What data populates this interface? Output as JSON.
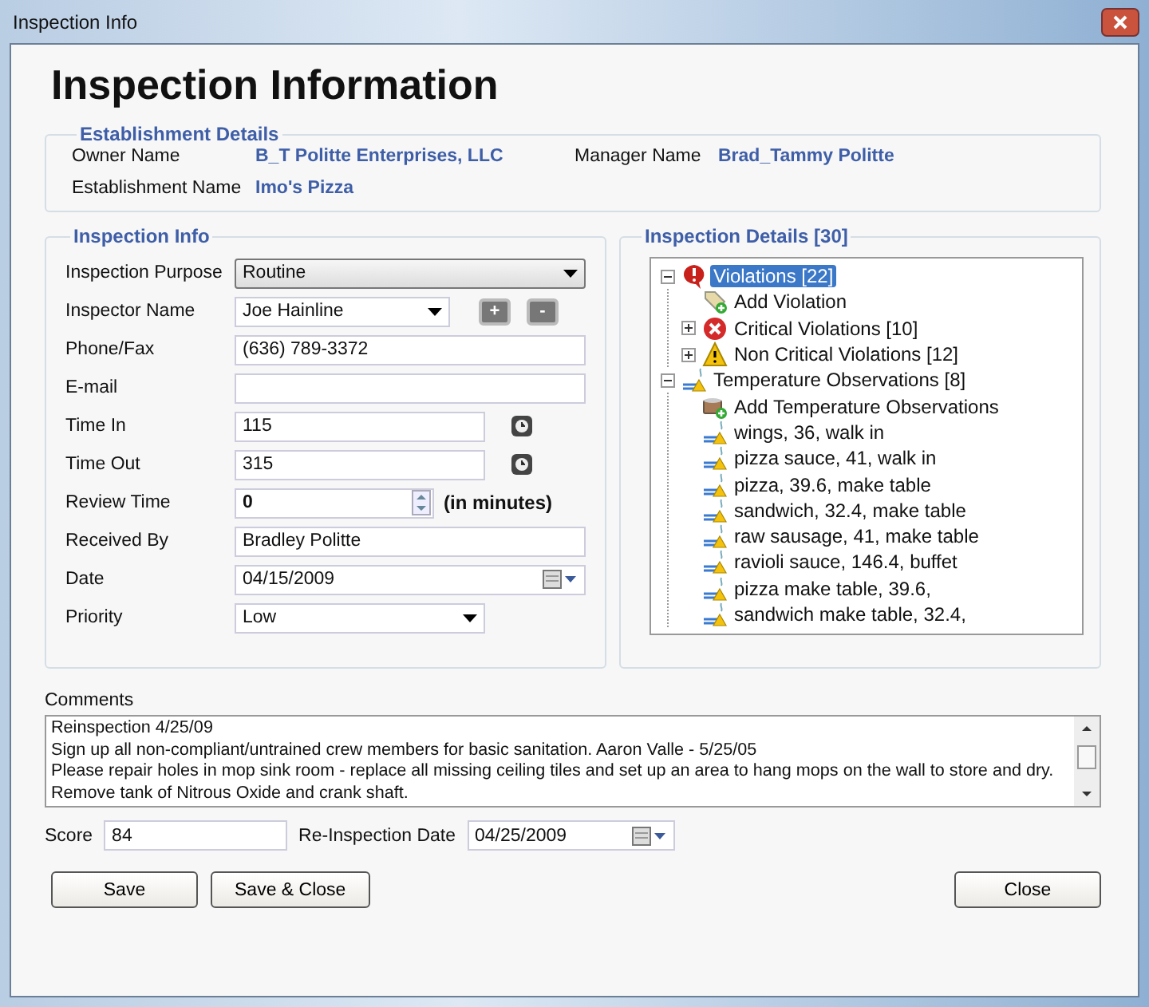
{
  "window": {
    "title": "Inspection Info"
  },
  "heading": "Inspection Information",
  "establishment": {
    "title": "Establishment Details",
    "fields": [
      {
        "label": "Owner Name",
        "value": "B_T Politte Enterprises, LLC"
      },
      {
        "label": "Manager Name",
        "value": "Brad_Tammy Politte"
      },
      {
        "label": "Establishment Name",
        "value": "Imo's Pizza"
      }
    ]
  },
  "inspection_info": {
    "title": "Inspection Info",
    "fields": [
      {
        "label": "Inspection Purpose",
        "kind": "select",
        "value": "Routine"
      },
      {
        "label": "Inspector Name",
        "kind": "combo",
        "value": "Joe Hainline",
        "actions": [
          "+",
          "-"
        ]
      },
      {
        "label": "Phone/Fax",
        "kind": "text",
        "value": "(636) 789-3372"
      },
      {
        "label": "E-mail",
        "kind": "text"
      },
      {
        "label": "Time In",
        "kind": "time",
        "value": "115"
      },
      {
        "label": "Time Out",
        "kind": "time",
        "value": "315"
      },
      {
        "label": "Review Time",
        "kind": "spin",
        "value": "0",
        "suffix": "(in minutes)"
      },
      {
        "label": "Received By",
        "kind": "text",
        "value": "Bradley Politte"
      },
      {
        "label": "Date",
        "kind": "date",
        "value": "04/15/2009"
      },
      {
        "label": "Priority",
        "kind": "combo",
        "value": "Low"
      }
    ]
  },
  "inspection_details": {
    "title": "Inspection Details [30]",
    "tree": [
      {
        "label": "Violations [22]",
        "kind": "violation",
        "selected": true,
        "expanded": true,
        "children": [
          {
            "label": "Add Violation",
            "kind": "add",
            "selected": false
          },
          {
            "label": "Critical Violations [10]",
            "kind": "critical",
            "selected": false,
            "expanded": false
          },
          {
            "label": "Non Critical Violations [12]",
            "kind": "warning",
            "selected": false,
            "expanded": false
          }
        ]
      },
      {
        "label": "Temperature Observations [8]",
        "kind": "temperature",
        "selected": false,
        "expanded": true,
        "children": [
          {
            "label": "Add Temperature Observations",
            "kind": "add-temperature",
            "selected": false
          },
          {
            "label": "wings, 36, walk in",
            "kind": "temperature",
            "selected": false
          },
          {
            "label": "pizza sauce, 41, walk in",
            "kind": "temperature",
            "selected": false
          },
          {
            "label": "pizza, 39.6, make table",
            "kind": "temperature",
            "selected": false
          },
          {
            "label": "sandwich, 32.4, make table",
            "kind": "temperature",
            "selected": false
          },
          {
            "label": "raw sausage, 41, make table",
            "kind": "temperature",
            "selected": false
          },
          {
            "label": "ravioli sauce, 146.4, buffet",
            "kind": "temperature",
            "selected": false
          },
          {
            "label": "pizza make table, 39.6,",
            "kind": "temperature",
            "selected": false
          },
          {
            "label": "sandwich make table, 32.4,",
            "kind": "temperature",
            "selected": false
          }
        ]
      }
    ]
  },
  "comments": {
    "label": "Comments",
    "lines": [
      "Reinspection 4/25/09",
      "Sign up all non-compliant/untrained crew members for basic sanitation.  Aaron Valle - 5/25/05",
      "Please repair holes in mop sink room - replace all missing ceiling tiles and set up an area to hang mops on the wall to store and dry.",
      "Remove tank of Nitrous Oxide and crank shaft."
    ]
  },
  "score": {
    "label": "Score",
    "value": "84"
  },
  "reinspection_date": {
    "label": "Re-Inspection Date",
    "value": "04/25/2009"
  },
  "buttons": {
    "left": [
      "Save",
      "Save & Close"
    ],
    "right": [
      "Close"
    ]
  }
}
